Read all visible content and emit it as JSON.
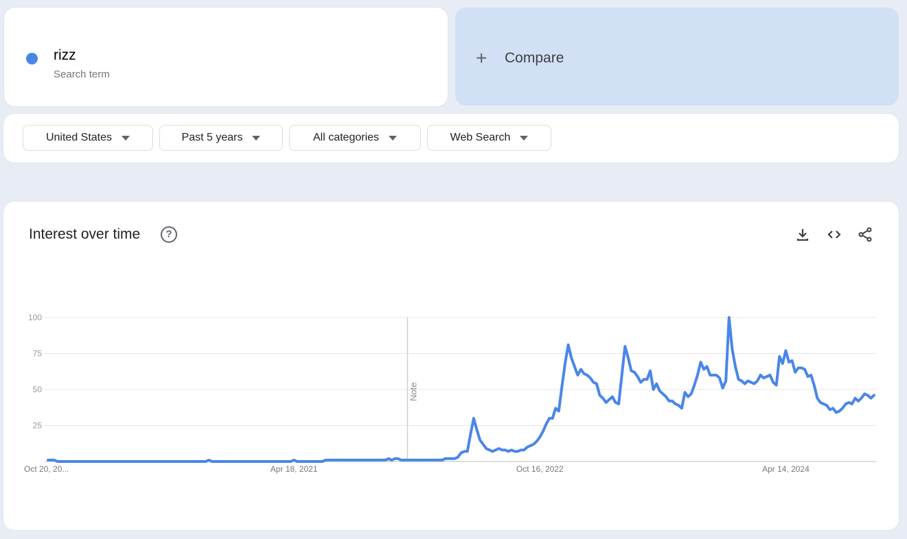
{
  "term": {
    "name": "rizz",
    "subtitle": "Search term",
    "color": "#4a86e8"
  },
  "compare": {
    "label": "Compare",
    "icon": "plus-icon"
  },
  "filters": [
    {
      "label": "United States"
    },
    {
      "label": "Past 5 years"
    },
    {
      "label": "All categories"
    },
    {
      "label": "Web Search"
    }
  ],
  "panel": {
    "title": "Interest over time",
    "help_icon": "help-circle-icon",
    "actions": [
      "download-icon",
      "embed-code-icon",
      "share-icon"
    ]
  },
  "chart_data": {
    "type": "line",
    "title": "Interest over time",
    "xlabel": "",
    "ylabel": "",
    "ylim": [
      0,
      100
    ],
    "yticks": [
      25,
      50,
      75,
      100
    ],
    "grid": true,
    "x_tick_labels": [
      {
        "label": "Oct 20, 20...",
        "week": 0
      },
      {
        "label": "Apr 18, 2021",
        "week": 78
      },
      {
        "label": "Oct 16, 2022",
        "week": 156
      },
      {
        "label": "Apr 14, 2024",
        "week": 234
      }
    ],
    "annotation": {
      "label": "Note",
      "week": 114
    },
    "series": [
      {
        "name": "rizz",
        "color": "#4a86e8",
        "keypoints": [
          [
            0,
            1
          ],
          [
            1,
            1
          ],
          [
            2,
            1
          ],
          [
            3,
            0
          ],
          [
            50,
            0
          ],
          [
            51,
            1
          ],
          [
            52,
            0
          ],
          [
            77,
            0
          ],
          [
            78,
            1
          ],
          [
            79,
            0
          ],
          [
            87,
            0
          ],
          [
            88,
            1
          ],
          [
            107,
            1
          ],
          [
            108,
            2
          ],
          [
            109,
            1
          ],
          [
            110,
            2
          ],
          [
            111,
            2
          ],
          [
            112,
            1
          ],
          [
            113,
            1
          ],
          [
            114,
            1
          ],
          [
            125,
            1
          ],
          [
            126,
            2
          ],
          [
            129,
            2
          ],
          [
            130,
            3
          ],
          [
            131,
            6
          ],
          [
            132,
            7
          ],
          [
            133,
            7
          ],
          [
            134,
            19
          ],
          [
            135,
            30
          ],
          [
            136,
            22
          ],
          [
            137,
            15
          ],
          [
            138,
            12
          ],
          [
            139,
            9
          ],
          [
            140,
            8
          ],
          [
            141,
            7
          ],
          [
            142,
            8
          ],
          [
            143,
            9
          ],
          [
            144,
            8
          ],
          [
            145,
            8
          ],
          [
            146,
            7
          ],
          [
            147,
            8
          ],
          [
            148,
            7
          ],
          [
            149,
            7
          ],
          [
            150,
            8
          ],
          [
            151,
            8
          ],
          [
            152,
            10
          ],
          [
            153,
            11
          ],
          [
            154,
            12
          ],
          [
            155,
            14
          ],
          [
            156,
            17
          ],
          [
            157,
            21
          ],
          [
            158,
            26
          ],
          [
            159,
            30
          ],
          [
            160,
            30
          ],
          [
            161,
            37
          ],
          [
            162,
            35
          ],
          [
            163,
            52
          ],
          [
            164,
            68
          ],
          [
            165,
            81
          ],
          [
            166,
            72
          ],
          [
            167,
            66
          ],
          [
            168,
            60
          ],
          [
            169,
            64
          ],
          [
            170,
            61
          ],
          [
            171,
            60
          ],
          [
            172,
            58
          ],
          [
            173,
            55
          ],
          [
            174,
            54
          ],
          [
            175,
            46
          ],
          [
            176,
            44
          ],
          [
            177,
            41
          ],
          [
            178,
            43
          ],
          [
            179,
            45
          ],
          [
            180,
            41
          ],
          [
            181,
            40
          ],
          [
            182,
            60
          ],
          [
            183,
            80
          ],
          [
            184,
            72
          ],
          [
            185,
            63
          ],
          [
            186,
            62
          ],
          [
            187,
            59
          ],
          [
            188,
            55
          ],
          [
            189,
            57
          ],
          [
            190,
            57
          ],
          [
            191,
            63
          ],
          [
            192,
            50
          ],
          [
            193,
            54
          ],
          [
            194,
            49
          ],
          [
            195,
            47
          ],
          [
            196,
            45
          ],
          [
            197,
            42
          ],
          [
            198,
            42
          ],
          [
            199,
            40
          ],
          [
            200,
            39
          ],
          [
            201,
            37
          ],
          [
            202,
            48
          ],
          [
            203,
            45
          ],
          [
            204,
            47
          ],
          [
            205,
            53
          ],
          [
            206,
            60
          ],
          [
            207,
            69
          ],
          [
            208,
            64
          ],
          [
            209,
            66
          ],
          [
            210,
            60
          ],
          [
            211,
            60
          ],
          [
            212,
            60
          ],
          [
            213,
            58
          ],
          [
            214,
            51
          ],
          [
            215,
            56
          ],
          [
            216,
            100
          ],
          [
            217,
            78
          ],
          [
            218,
            66
          ],
          [
            219,
            57
          ],
          [
            220,
            56
          ],
          [
            221,
            54
          ],
          [
            222,
            56
          ],
          [
            223,
            55
          ],
          [
            224,
            54
          ],
          [
            225,
            56
          ],
          [
            226,
            60
          ],
          [
            227,
            58
          ],
          [
            228,
            59
          ],
          [
            229,
            60
          ],
          [
            230,
            55
          ],
          [
            231,
            53
          ],
          [
            232,
            73
          ],
          [
            233,
            68
          ],
          [
            234,
            77
          ],
          [
            235,
            69
          ],
          [
            236,
            70
          ],
          [
            237,
            62
          ],
          [
            238,
            65
          ],
          [
            239,
            65
          ],
          [
            240,
            64
          ],
          [
            241,
            59
          ],
          [
            242,
            60
          ],
          [
            243,
            53
          ],
          [
            244,
            44
          ],
          [
            245,
            41
          ],
          [
            246,
            40
          ],
          [
            247,
            39
          ],
          [
            248,
            36
          ],
          [
            249,
            37
          ],
          [
            250,
            34
          ],
          [
            251,
            35
          ],
          [
            252,
            37
          ],
          [
            253,
            40
          ],
          [
            254,
            41
          ],
          [
            255,
            40
          ],
          [
            256,
            44
          ],
          [
            257,
            42
          ],
          [
            258,
            44
          ],
          [
            259,
            47
          ],
          [
            260,
            46
          ],
          [
            261,
            44
          ],
          [
            262,
            46
          ]
        ]
      }
    ]
  }
}
